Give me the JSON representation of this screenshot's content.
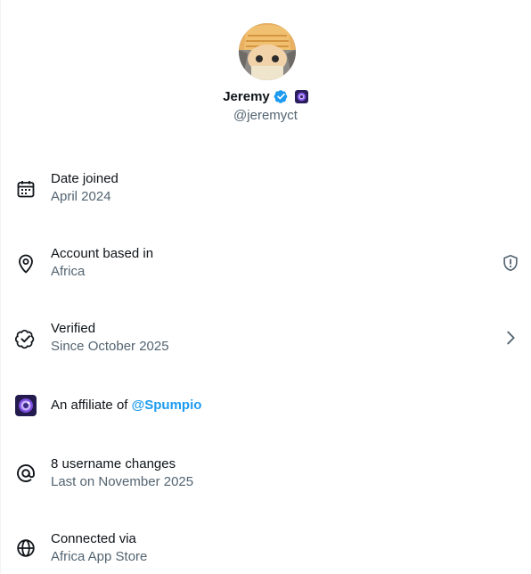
{
  "profile": {
    "display_name": "Jeremy",
    "handle": "@jeremyct"
  },
  "rows": {
    "date_joined": {
      "title": "Date joined",
      "value": "April 2024",
      "icon": "calendar-icon"
    },
    "account_based": {
      "title": "Account based in",
      "value": "Africa",
      "icon": "location-pin-icon",
      "right_icon": "shield-alert-icon"
    },
    "verified": {
      "title": "Verified",
      "value": "Since October 2025",
      "icon": "verified-badge-icon",
      "right_icon": "chevron-right-icon"
    },
    "affiliate": {
      "prefix": "An affiliate of ",
      "mention": "@Spumpio",
      "icon": "affiliate-logo-icon"
    },
    "username_changes": {
      "title": "8 username changes",
      "value": "Last on November 2025",
      "icon": "at-sign-icon"
    },
    "connected_via": {
      "title": "Connected via",
      "value": "Africa App Store",
      "icon": "globe-icon"
    }
  },
  "colors": {
    "text_primary": "#0f1419",
    "text_secondary": "#536471",
    "accent_blue": "#1d9bf0"
  }
}
